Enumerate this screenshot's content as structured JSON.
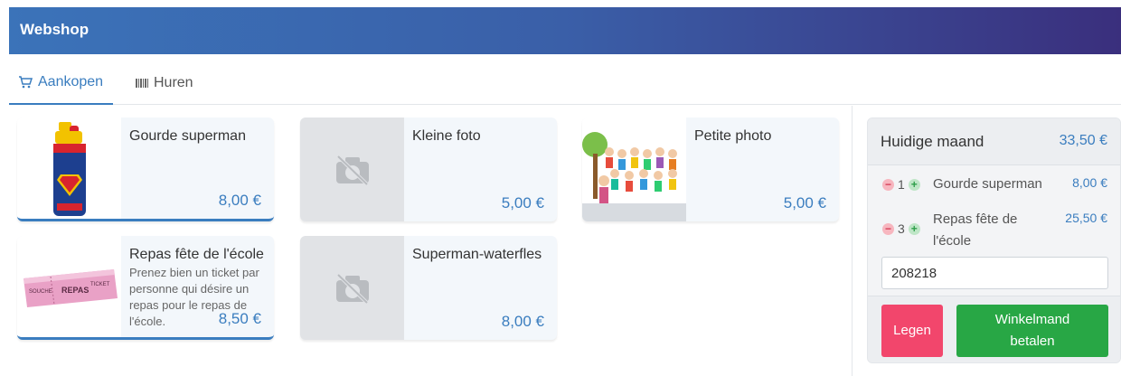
{
  "header": {
    "title": "Webshop"
  },
  "tabs": [
    {
      "label": "Aankopen",
      "icon": "cart-icon",
      "active": true
    },
    {
      "label": "Huren",
      "icon": "barcode-icon",
      "active": false
    }
  ],
  "products": [
    {
      "name": "Gourde superman",
      "description": "",
      "price": "8,00 €",
      "image": "water-bottle-image",
      "selected": true
    },
    {
      "name": "Kleine foto",
      "description": "",
      "price": "5,00 €",
      "image": "no-image-icon",
      "selected": false
    },
    {
      "name": "Petite photo",
      "description": "",
      "price": "5,00 €",
      "image": "children-group-image",
      "selected": false
    },
    {
      "name": "Repas fête de l'école",
      "description": "Prenez bien un ticket par personne qui désire un repas pour le repas de l'école.",
      "price": "8,50 €",
      "image": "meal-ticket-image",
      "selected": true
    },
    {
      "name": "Superman-waterfles",
      "description": "",
      "price": "8,00 €",
      "image": "no-image-icon",
      "selected": false
    }
  ],
  "cart": {
    "title": "Huidige maand",
    "total": "33,50 €",
    "lines": [
      {
        "qty": "1",
        "name": "Gourde superman",
        "price": "8,00 €"
      },
      {
        "qty": "3",
        "name": "Repas fête de l'école",
        "price": "25,50 €"
      }
    ],
    "code_value": "208218",
    "clear_label": "Legen",
    "pay_label": "Winkelmand betalen"
  },
  "colors": {
    "accent": "#3a7dbf",
    "danger": "#f2466c",
    "success": "#28a745"
  }
}
